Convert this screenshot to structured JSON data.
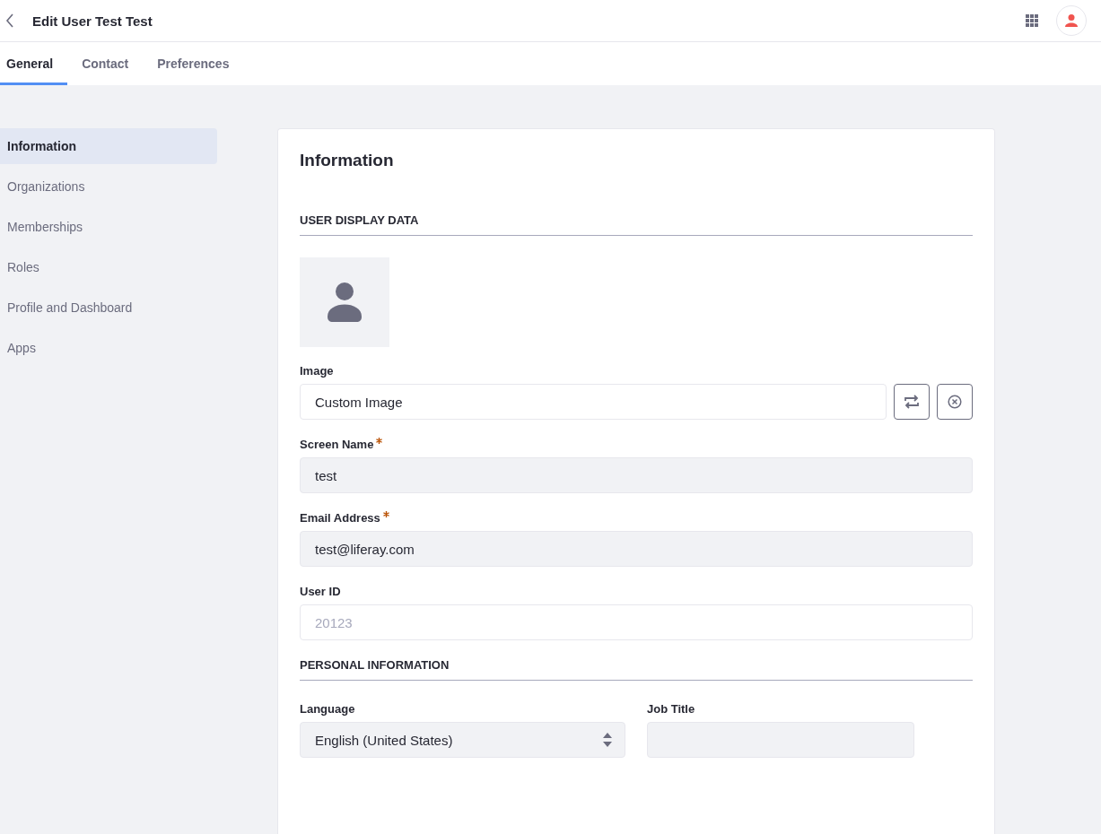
{
  "header": {
    "title": "Edit User Test Test"
  },
  "tabs": [
    {
      "label": "General",
      "selected": true
    },
    {
      "label": "Contact",
      "selected": false
    },
    {
      "label": "Preferences",
      "selected": false
    }
  ],
  "sidebar": {
    "items": [
      {
        "label": "Information",
        "selected": true
      },
      {
        "label": "Organizations",
        "selected": false
      },
      {
        "label": "Memberships",
        "selected": false
      },
      {
        "label": "Roles",
        "selected": false
      },
      {
        "label": "Profile and Dashboard",
        "selected": false
      },
      {
        "label": "Apps",
        "selected": false
      }
    ]
  },
  "panel": {
    "title": "Information",
    "sections": [
      {
        "heading": "USER DISPLAY DATA",
        "rows": [
          {
            "fields": [
              {
                "kind": "avatar"
              }
            ]
          },
          {
            "fields": [
              {
                "kind": "image",
                "label": "Image",
                "value": "Custom Image",
                "required": false,
                "readonly": false
              }
            ]
          },
          {
            "fields": [
              {
                "kind": "input",
                "label": "Screen Name",
                "value": "test",
                "required": true,
                "readonly": true
              }
            ]
          },
          {
            "fields": [
              {
                "kind": "input",
                "label": "Email Address",
                "value": "test@liferay.com",
                "required": true,
                "readonly": true
              }
            ]
          },
          {
            "fields": [
              {
                "kind": "input",
                "label": "User ID",
                "placeholder": "20123",
                "required": false,
                "readonly": false
              }
            ]
          }
        ]
      },
      {
        "heading": "PERSONAL INFORMATION",
        "rows": [
          {
            "fields": [
              {
                "kind": "select",
                "label": "Language",
                "value": "English (United States)",
                "required": false,
                "readonly": true
              },
              {
                "kind": "input",
                "label": "Job Title",
                "required": false,
                "readonly": true
              }
            ]
          }
        ]
      }
    ]
  }
}
